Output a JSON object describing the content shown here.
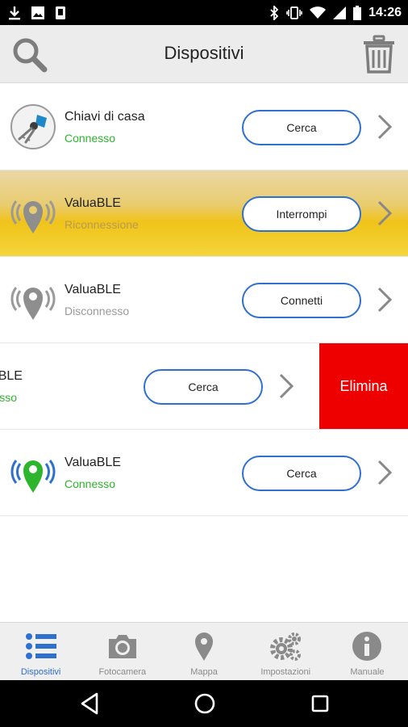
{
  "status_bar": {
    "time": "14:26",
    "left_icons": [
      "download-icon",
      "image-icon",
      "phone-vibrate-icon"
    ],
    "right_icons": [
      "bluetooth-icon",
      "vibrate-icon",
      "wifi-icon",
      "signal-icon",
      "battery-icon"
    ]
  },
  "header": {
    "title": "Dispositivi",
    "left_icon": "search-icon",
    "right_icon": "trash-icon"
  },
  "devices": [
    {
      "name": "Chiavi di casa",
      "status": "Connesso",
      "action": "Cerca",
      "icon": "keys-icon",
      "status_color": "green"
    },
    {
      "name": "ValuaBLE",
      "status": "Riconnessione",
      "action": "Interrompi",
      "icon": "pin-signal-icon",
      "status_color": "faded"
    },
    {
      "name": "ValuaBLE",
      "status": "Disconnesso",
      "action": "Connetti",
      "icon": "pin-signal-icon",
      "status_color": "grey"
    },
    {
      "name": "ValuaBLE",
      "status": "Connesso",
      "action": "Cerca",
      "icon": "pin-signal-icon",
      "status_color": "green",
      "delete_label": "Elimina"
    },
    {
      "name": "ValuaBLE",
      "status": "Connesso",
      "action": "Cerca",
      "icon": "pin-signal-green-icon",
      "status_color": "green"
    }
  ],
  "bottom_nav": [
    {
      "label": "Dispositivi",
      "icon": "list-icon",
      "active": true
    },
    {
      "label": "Fotocamera",
      "icon": "camera-icon",
      "active": false
    },
    {
      "label": "Mappa",
      "icon": "map-pin-icon",
      "active": false
    },
    {
      "label": "Impostazioni",
      "icon": "gears-icon",
      "active": false
    },
    {
      "label": "Manuale",
      "icon": "info-icon",
      "active": false
    }
  ],
  "colors": {
    "accent": "#2f6fce",
    "connected": "#2db52d",
    "delete": "#ee0000",
    "reconnecting_bg": "#f0c319"
  }
}
